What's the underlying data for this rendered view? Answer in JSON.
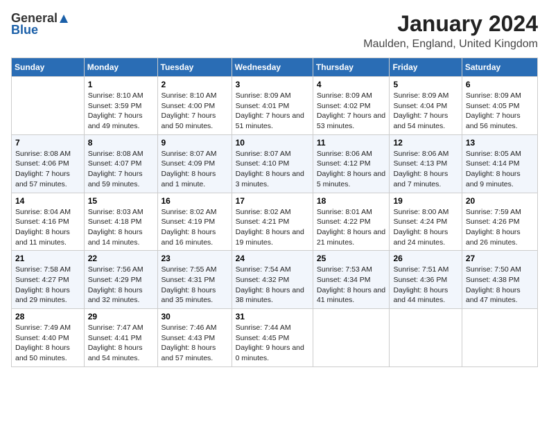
{
  "header": {
    "logo_general": "General",
    "logo_blue": "Blue",
    "month": "January 2024",
    "location": "Maulden, England, United Kingdom"
  },
  "days_of_week": [
    "Sunday",
    "Monday",
    "Tuesday",
    "Wednesday",
    "Thursday",
    "Friday",
    "Saturday"
  ],
  "weeks": [
    [
      {
        "day": "",
        "sunrise": "",
        "sunset": "",
        "daylight": ""
      },
      {
        "day": "1",
        "sunrise": "Sunrise: 8:10 AM",
        "sunset": "Sunset: 3:59 PM",
        "daylight": "Daylight: 7 hours and 49 minutes."
      },
      {
        "day": "2",
        "sunrise": "Sunrise: 8:10 AM",
        "sunset": "Sunset: 4:00 PM",
        "daylight": "Daylight: 7 hours and 50 minutes."
      },
      {
        "day": "3",
        "sunrise": "Sunrise: 8:09 AM",
        "sunset": "Sunset: 4:01 PM",
        "daylight": "Daylight: 7 hours and 51 minutes."
      },
      {
        "day": "4",
        "sunrise": "Sunrise: 8:09 AM",
        "sunset": "Sunset: 4:02 PM",
        "daylight": "Daylight: 7 hours and 53 minutes."
      },
      {
        "day": "5",
        "sunrise": "Sunrise: 8:09 AM",
        "sunset": "Sunset: 4:04 PM",
        "daylight": "Daylight: 7 hours and 54 minutes."
      },
      {
        "day": "6",
        "sunrise": "Sunrise: 8:09 AM",
        "sunset": "Sunset: 4:05 PM",
        "daylight": "Daylight: 7 hours and 56 minutes."
      }
    ],
    [
      {
        "day": "7",
        "sunrise": "Sunrise: 8:08 AM",
        "sunset": "Sunset: 4:06 PM",
        "daylight": "Daylight: 7 hours and 57 minutes."
      },
      {
        "day": "8",
        "sunrise": "Sunrise: 8:08 AM",
        "sunset": "Sunset: 4:07 PM",
        "daylight": "Daylight: 7 hours and 59 minutes."
      },
      {
        "day": "9",
        "sunrise": "Sunrise: 8:07 AM",
        "sunset": "Sunset: 4:09 PM",
        "daylight": "Daylight: 8 hours and 1 minute."
      },
      {
        "day": "10",
        "sunrise": "Sunrise: 8:07 AM",
        "sunset": "Sunset: 4:10 PM",
        "daylight": "Daylight: 8 hours and 3 minutes."
      },
      {
        "day": "11",
        "sunrise": "Sunrise: 8:06 AM",
        "sunset": "Sunset: 4:12 PM",
        "daylight": "Daylight: 8 hours and 5 minutes."
      },
      {
        "day": "12",
        "sunrise": "Sunrise: 8:06 AM",
        "sunset": "Sunset: 4:13 PM",
        "daylight": "Daylight: 8 hours and 7 minutes."
      },
      {
        "day": "13",
        "sunrise": "Sunrise: 8:05 AM",
        "sunset": "Sunset: 4:14 PM",
        "daylight": "Daylight: 8 hours and 9 minutes."
      }
    ],
    [
      {
        "day": "14",
        "sunrise": "Sunrise: 8:04 AM",
        "sunset": "Sunset: 4:16 PM",
        "daylight": "Daylight: 8 hours and 11 minutes."
      },
      {
        "day": "15",
        "sunrise": "Sunrise: 8:03 AM",
        "sunset": "Sunset: 4:18 PM",
        "daylight": "Daylight: 8 hours and 14 minutes."
      },
      {
        "day": "16",
        "sunrise": "Sunrise: 8:02 AM",
        "sunset": "Sunset: 4:19 PM",
        "daylight": "Daylight: 8 hours and 16 minutes."
      },
      {
        "day": "17",
        "sunrise": "Sunrise: 8:02 AM",
        "sunset": "Sunset: 4:21 PM",
        "daylight": "Daylight: 8 hours and 19 minutes."
      },
      {
        "day": "18",
        "sunrise": "Sunrise: 8:01 AM",
        "sunset": "Sunset: 4:22 PM",
        "daylight": "Daylight: 8 hours and 21 minutes."
      },
      {
        "day": "19",
        "sunrise": "Sunrise: 8:00 AM",
        "sunset": "Sunset: 4:24 PM",
        "daylight": "Daylight: 8 hours and 24 minutes."
      },
      {
        "day": "20",
        "sunrise": "Sunrise: 7:59 AM",
        "sunset": "Sunset: 4:26 PM",
        "daylight": "Daylight: 8 hours and 26 minutes."
      }
    ],
    [
      {
        "day": "21",
        "sunrise": "Sunrise: 7:58 AM",
        "sunset": "Sunset: 4:27 PM",
        "daylight": "Daylight: 8 hours and 29 minutes."
      },
      {
        "day": "22",
        "sunrise": "Sunrise: 7:56 AM",
        "sunset": "Sunset: 4:29 PM",
        "daylight": "Daylight: 8 hours and 32 minutes."
      },
      {
        "day": "23",
        "sunrise": "Sunrise: 7:55 AM",
        "sunset": "Sunset: 4:31 PM",
        "daylight": "Daylight: 8 hours and 35 minutes."
      },
      {
        "day": "24",
        "sunrise": "Sunrise: 7:54 AM",
        "sunset": "Sunset: 4:32 PM",
        "daylight": "Daylight: 8 hours and 38 minutes."
      },
      {
        "day": "25",
        "sunrise": "Sunrise: 7:53 AM",
        "sunset": "Sunset: 4:34 PM",
        "daylight": "Daylight: 8 hours and 41 minutes."
      },
      {
        "day": "26",
        "sunrise": "Sunrise: 7:51 AM",
        "sunset": "Sunset: 4:36 PM",
        "daylight": "Daylight: 8 hours and 44 minutes."
      },
      {
        "day": "27",
        "sunrise": "Sunrise: 7:50 AM",
        "sunset": "Sunset: 4:38 PM",
        "daylight": "Daylight: 8 hours and 47 minutes."
      }
    ],
    [
      {
        "day": "28",
        "sunrise": "Sunrise: 7:49 AM",
        "sunset": "Sunset: 4:40 PM",
        "daylight": "Daylight: 8 hours and 50 minutes."
      },
      {
        "day": "29",
        "sunrise": "Sunrise: 7:47 AM",
        "sunset": "Sunset: 4:41 PM",
        "daylight": "Daylight: 8 hours and 54 minutes."
      },
      {
        "day": "30",
        "sunrise": "Sunrise: 7:46 AM",
        "sunset": "Sunset: 4:43 PM",
        "daylight": "Daylight: 8 hours and 57 minutes."
      },
      {
        "day": "31",
        "sunrise": "Sunrise: 7:44 AM",
        "sunset": "Sunset: 4:45 PM",
        "daylight": "Daylight: 9 hours and 0 minutes."
      },
      {
        "day": "",
        "sunrise": "",
        "sunset": "",
        "daylight": ""
      },
      {
        "day": "",
        "sunrise": "",
        "sunset": "",
        "daylight": ""
      },
      {
        "day": "",
        "sunrise": "",
        "sunset": "",
        "daylight": ""
      }
    ]
  ]
}
